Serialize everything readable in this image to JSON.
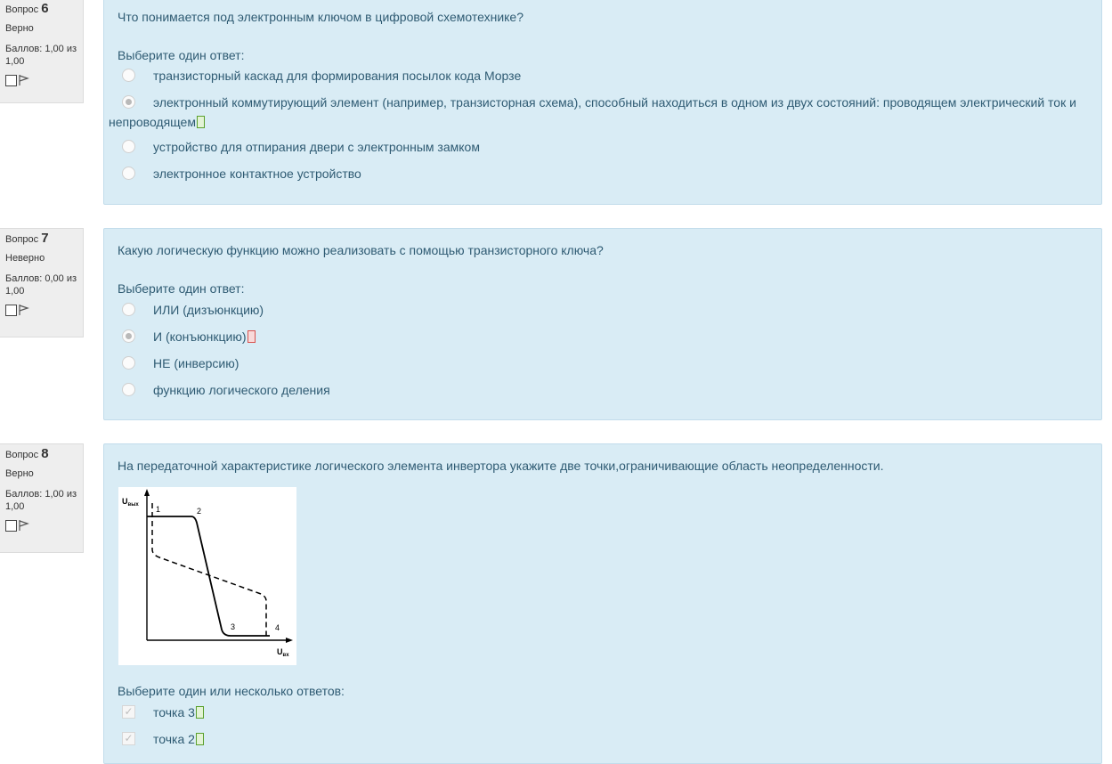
{
  "questions": [
    {
      "number_prefix": "Вопрос",
      "number": "6",
      "state": "Верно",
      "grade": "Баллов: 1,00 из 1,00",
      "text": "Что понимается под электронным ключом в цифровой схемотехнике?",
      "prompt": "Выберите один ответ:",
      "options": [
        {
          "label": "транзисторный каскад для формирования посылок кода Морзе",
          "checked": false
        },
        {
          "label": "электронный коммутирующий элемент (например, транзисторная схема), способный находиться в одном из двух состояний: проводящем электрический ток и непроводящем",
          "checked": true,
          "mark": "correct"
        },
        {
          "label": "устройство для отпирания двери с электронным замком",
          "checked": false
        },
        {
          "label": "электронное контактное устройство",
          "checked": false
        }
      ]
    },
    {
      "number_prefix": "Вопрос",
      "number": "7",
      "state": "Неверно",
      "grade": "Баллов: 0,00 из 1,00",
      "text": "Какую логическую функцию можно реализовать с помощью транзисторного ключа?",
      "prompt": "Выберите один ответ:",
      "options": [
        {
          "label": "ИЛИ (дизъюнкцию)",
          "checked": false
        },
        {
          "label": "И (конъюнкцию)",
          "checked": true,
          "mark": "incorrect"
        },
        {
          "label": "НЕ (инверсию)",
          "checked": false
        },
        {
          "label": "функцию логического деления",
          "checked": false
        }
      ]
    },
    {
      "number_prefix": "Вопрос",
      "number": "8",
      "state": "Верно",
      "grade": "Баллов: 1,00 из 1,00",
      "text": "На передаточной характеристике логического элемента инвертора укажите две точки,ограничивающие область неопределенности.",
      "prompt": "Выберите один или несколько ответов:",
      "diagram": {
        "y_axis_label": "U",
        "y_axis_sub": "вых",
        "x_axis_label": "U",
        "x_axis_sub": "вх",
        "point_labels": [
          "1",
          "2",
          "3",
          "4"
        ]
      },
      "options": [
        {
          "label": "точка 3",
          "checked": true,
          "mark": "correct"
        },
        {
          "label": "точка 2",
          "checked": true,
          "mark": "correct"
        }
      ]
    }
  ],
  "colors": {
    "content_bg": "#d9ecf5",
    "info_bg": "#eeeeee",
    "text": "#2f5b73",
    "correct": "#5aa02c",
    "incorrect": "#d9534f"
  },
  "icons": {
    "flag": "flag-icon",
    "checkbox_flag": "flag-checkbox",
    "check": "checkmark-icon"
  }
}
